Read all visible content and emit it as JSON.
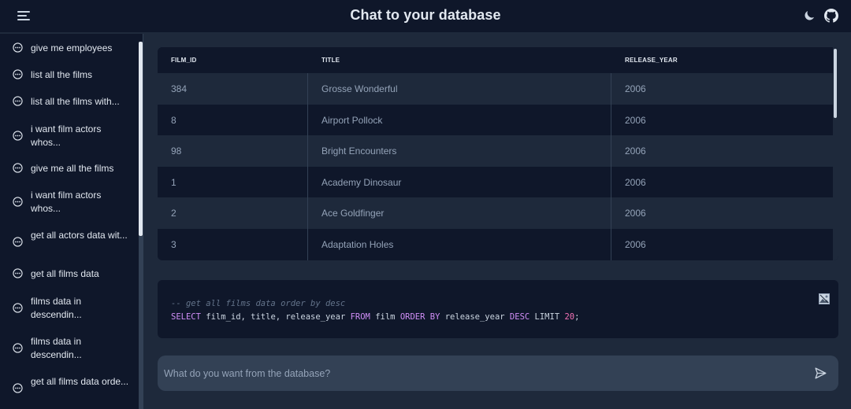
{
  "app": {
    "title": "Chat to your database"
  },
  "header": {
    "menu_icon": "menu-icon",
    "theme_icon": "moon-icon",
    "github_icon": "github-icon"
  },
  "sidebar": {
    "items": [
      {
        "label": "give me employees"
      },
      {
        "label": "list all the films"
      },
      {
        "label": "list all the films with..."
      },
      {
        "label": "i want film actors whos..."
      },
      {
        "label": "give me all the films"
      },
      {
        "label": "i want film actors whos..."
      },
      {
        "label": "get all actors data wit..."
      },
      {
        "label": "get all films data"
      },
      {
        "label": "films data in descendin..."
      },
      {
        "label": "films data in descendin..."
      },
      {
        "label": "get all films data orde..."
      }
    ]
  },
  "results": {
    "columns": [
      "FILM_ID",
      "TITLE",
      "RELEASE_YEAR"
    ],
    "rows": [
      [
        "384",
        "Grosse Wonderful",
        "2006"
      ],
      [
        "8",
        "Airport Pollock",
        "2006"
      ],
      [
        "98",
        "Bright Encounters",
        "2006"
      ],
      [
        "1",
        "Academy Dinosaur",
        "2006"
      ],
      [
        "2",
        "Ace Goldfinger",
        "2006"
      ],
      [
        "3",
        "Adaptation Holes",
        "2006"
      ]
    ]
  },
  "sql": {
    "comment": "-- get all films data order by desc",
    "kw_select": "SELECT",
    "fields": " film_id, title, release_year ",
    "kw_from": "FROM",
    "table": " film ",
    "kw_order": "ORDER BY",
    "order_field": " release_year ",
    "kw_desc": "DESC",
    "kw_limit": " LIMIT ",
    "limit": "20",
    "end": ";"
  },
  "prompt": {
    "placeholder": "What do you want from the database?",
    "value": ""
  },
  "colors": {
    "background": "#1e293b",
    "panel": "#0f172a",
    "keyword": "#d08ef7",
    "number": "#f472b6",
    "input": "#334155"
  }
}
